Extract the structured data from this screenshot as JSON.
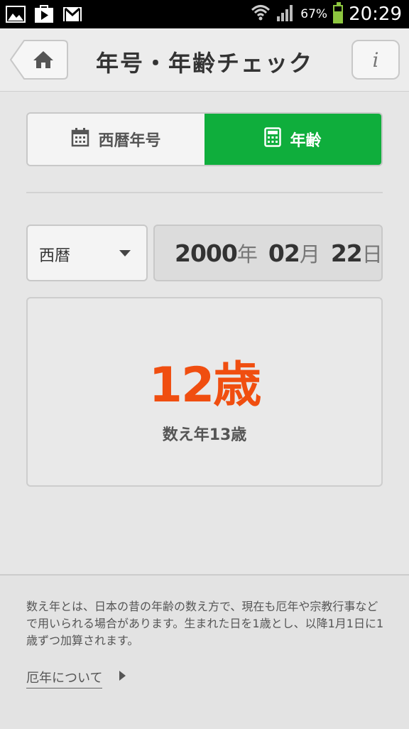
{
  "status_bar": {
    "battery_percent_text": "67%",
    "battery_level": 0.67,
    "time": "20:29",
    "icons": [
      "image-icon",
      "play-store-icon",
      "gmail-icon",
      "wifi-icon",
      "signal-icon",
      "battery-icon"
    ]
  },
  "header": {
    "title": "年号・年齢チェック",
    "info_label": "i",
    "home_icon": "home-icon"
  },
  "tabs": [
    {
      "label": "西暦年号",
      "icon": "calendar-icon",
      "selected": false
    },
    {
      "label": "年齢",
      "icon": "calculator-icon",
      "selected": true
    }
  ],
  "date_input": {
    "era": "西暦",
    "year": "2000",
    "year_unit": "年",
    "month": "02",
    "month_unit": "月",
    "day": "22",
    "day_unit": "日"
  },
  "result": {
    "age": "12歳",
    "kazoe": "数え年13歳"
  },
  "footer": {
    "description": "数え年とは、日本の昔の年齢の数え方で、現在も厄年や宗教行事などで用いられる場合があります。生まれた日を1歳とし、以降1月1日に1歳ずつ加算されます。",
    "link_label": "厄年について"
  },
  "colors": {
    "accent_green": "#0fae3c",
    "age_orange": "#f04e10",
    "battery_green": "#8dc63f"
  }
}
